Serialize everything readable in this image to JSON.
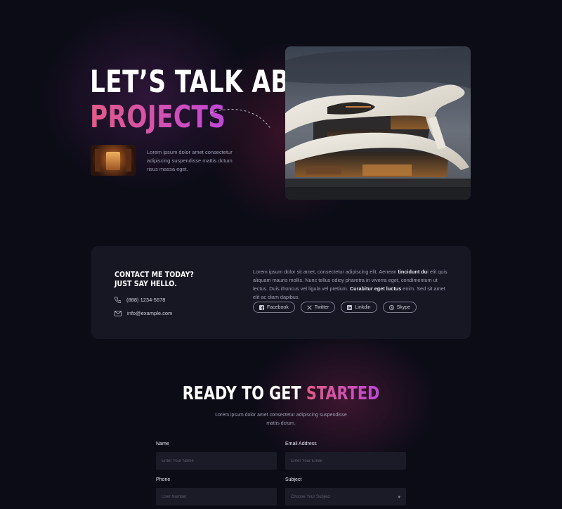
{
  "hero": {
    "title_line1": "LET’S TALK ABOUT",
    "title_line2": "PROJECTS",
    "description": "Lorem ipsum dolor amet consectetur adipiscing suspendisse mattis dctum risus massa eget."
  },
  "contact": {
    "heading_line1": "CONTACT ME TODAY?",
    "heading_line2": "JUST SAY HELLO.",
    "phone": "(888) 1234-5678",
    "email": "info@example.com",
    "about_parts": [
      "Lorem ipsum dolor sit amet, consectetur adipiscing elit. Aenean ",
      "tincidunt du",
      "i elit quis aliquam mauris mollis. Nunc tellus odioy pharetra in viverra eget, condimentum ut lectus. Duis rhoncus vel ligula vel pretium. ",
      "Curabitur eget luctus",
      " enim. Sed sit amet elit ac diam dapibus."
    ],
    "socials": [
      {
        "label": "Facebook",
        "icon": "facebook-icon"
      },
      {
        "label": "Twitter",
        "icon": "x-twitter-icon"
      },
      {
        "label": "Linkdin",
        "icon": "linkedin-icon"
      },
      {
        "label": "Skype",
        "icon": "skype-icon"
      }
    ]
  },
  "form_section": {
    "title_white": "READY TO GET ",
    "title_gradient": "STARTED",
    "subtitle": "Lorem ipsum dolor amet consectetur adipiscing suspendisse mattis dctum.",
    "fields": {
      "name_label": "Name",
      "name_placeholder": "Enter Your Name",
      "email_label": "Email Address",
      "email_placeholder": "Enter Your Email",
      "phone_label": "Phone",
      "phone_placeholder": "User Number",
      "subject_label": "Subject",
      "subject_selected": "Choose Your Subject"
    }
  },
  "colors": {
    "background": "#0c0c17",
    "card": "#171724",
    "accent_pink": "#e45a86",
    "accent_purple": "#c048d8"
  }
}
